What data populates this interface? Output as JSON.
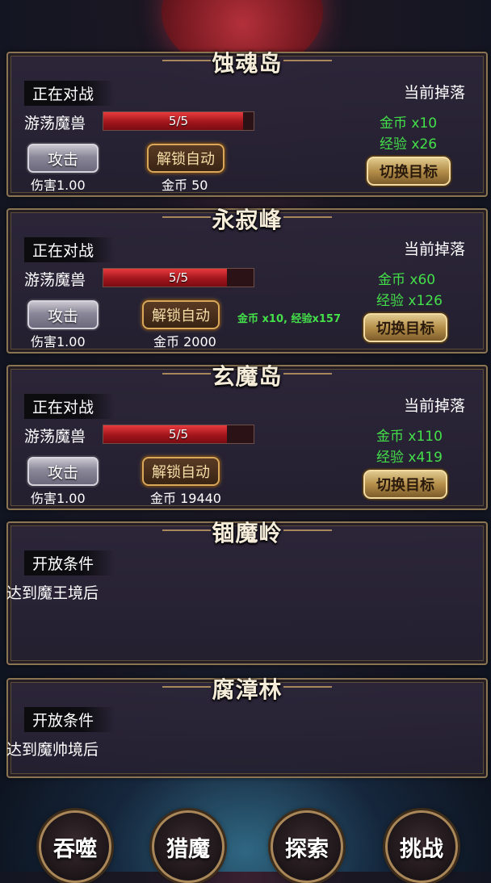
{
  "zones": [
    {
      "name": "蚀魂岛",
      "battle_label": "正在对战",
      "monster": "游荡魔兽",
      "hp_text": "5/5",
      "hp_fraction": 0.93,
      "attack_label": "攻击",
      "unlock_label": "解锁自动",
      "damage": "伤害1.00",
      "cost": "金币 50",
      "drop_title": "当前掉落",
      "drop_gold": "金币 x10",
      "drop_exp": "经验 x26",
      "switch_label": "切换目标"
    },
    {
      "name": "永寂峰",
      "battle_label": "正在对战",
      "monster": "游荡魔兽",
      "hp_text": "5/5",
      "hp_fraction": 0.82,
      "attack_label": "攻击",
      "unlock_label": "解锁自动",
      "damage": "伤害1.00",
      "cost": "金币 2000",
      "bonus": "金币 x10, 经验x157",
      "drop_title": "当前掉落",
      "drop_gold": "金币 x60",
      "drop_exp": "经验 x126",
      "switch_label": "切换目标"
    },
    {
      "name": "玄魔岛",
      "battle_label": "正在对战",
      "monster": "游荡魔兽",
      "hp_text": "5/5",
      "hp_fraction": 0.82,
      "attack_label": "攻击",
      "unlock_label": "解锁自动",
      "damage": "伤害1.00",
      "cost": "金币 19440",
      "drop_title": "当前掉落",
      "drop_gold": "金币 x110",
      "drop_exp": "经验 x419",
      "switch_label": "切换目标"
    }
  ],
  "locked_zones": [
    {
      "name": "锢魔岭",
      "cond_label": "开放条件",
      "cond_text": "达到魔王境后"
    },
    {
      "name": "腐漳林",
      "cond_label": "开放条件",
      "cond_text": "达到魔帅境后"
    }
  ],
  "nav": [
    "吞噬",
    "猎魔",
    "探索",
    "挑战"
  ],
  "colors": {
    "drop_green": "#44e04a",
    "frame_gold": "#8a7452",
    "hp_red": "#c8202a"
  }
}
